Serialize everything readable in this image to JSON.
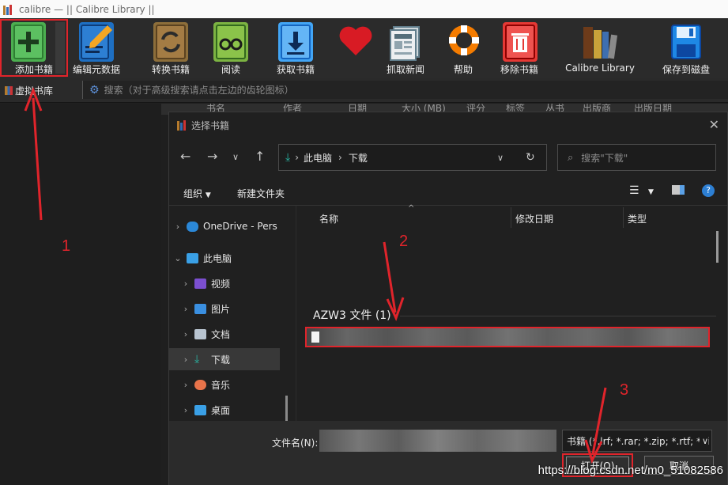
{
  "window": {
    "title": "calibre — || Calibre Library ||"
  },
  "toolbar": [
    {
      "id": "add",
      "label": "添加书籍",
      "icon": "add-book-icon",
      "color": "#4caf50"
    },
    {
      "id": "edit",
      "label": "编辑元数据",
      "icon": "edit-metadata-icon",
      "color": "#1e88e5"
    },
    {
      "id": "convert",
      "label": "转换书籍",
      "icon": "convert-book-icon",
      "color": "#8d6e3a"
    },
    {
      "id": "view",
      "label": "阅读",
      "icon": "view-book-icon",
      "color": "#7cb342"
    },
    {
      "id": "fetch",
      "label": "获取书籍",
      "icon": "get-books-icon",
      "color": "#42a5f5"
    },
    {
      "id": "donate",
      "label": "",
      "icon": "heart-icon",
      "color": "#d81b24"
    },
    {
      "id": "news",
      "label": "抓取新闻",
      "icon": "news-icon",
      "color": "#9e9e9e"
    },
    {
      "id": "help",
      "label": "帮助",
      "icon": "lifebuoy-icon",
      "color": "#f57c00"
    },
    {
      "id": "remove",
      "label": "移除书籍",
      "icon": "remove-book-icon",
      "color": "#e53935"
    },
    {
      "id": "library",
      "label": "Calibre Library",
      "icon": "library-icon",
      "color": "#795548"
    },
    {
      "id": "save",
      "label": "保存到磁盘",
      "icon": "save-disk-icon",
      "color": "#1976d2"
    }
  ],
  "virtual_library": "虚拟书库",
  "search_placeholder": "搜索（对于高级搜索请点击左边的齿轮图标）",
  "columns": [
    "书名",
    "作者",
    "日期",
    "大小 (MB)",
    "评分",
    "标签",
    "丛书",
    "出版商",
    "出版日期"
  ],
  "dialog": {
    "title": "选择书籍",
    "breadcrumb": [
      "此电脑",
      "下载"
    ],
    "search_placeholder": "搜索\"下载\"",
    "organize": "组织",
    "new_folder": "新建文件夹",
    "nav": [
      {
        "label": "OneDrive - Pers",
        "icon": "onedrive-icon",
        "color": "#2b88d8"
      },
      {
        "label": "此电脑",
        "icon": "computer-icon",
        "color": "#3aa0e6"
      },
      {
        "label": "视频",
        "icon": "video-folder-icon",
        "color": "#7b4fd0"
      },
      {
        "label": "图片",
        "icon": "pictures-folder-icon",
        "color": "#3a8fe0"
      },
      {
        "label": "文档",
        "icon": "documents-folder-icon",
        "color": "#b8c4d0"
      },
      {
        "label": "下载",
        "icon": "downloads-folder-icon",
        "color": "#2ab3a2"
      },
      {
        "label": "音乐",
        "icon": "music-folder-icon",
        "color": "#e8734a"
      },
      {
        "label": "桌面",
        "icon": "desktop-folder-icon",
        "color": "#3aa0e6"
      }
    ],
    "file_columns": [
      "名称",
      "修改日期",
      "类型"
    ],
    "group_label": "AZW3 文件 (1)",
    "filename_label": "文件名(N):",
    "filter_text": "书籍 (*.lrf; *.rar; *.zip; *.rtf; *.li",
    "open_button": "打开(O)",
    "cancel_button": "取消"
  },
  "annotations": [
    "1",
    "2",
    "3"
  ],
  "watermark": "https://blog.csdn.net/m0_51082586",
  "colors": {
    "highlight": "#e0242b"
  }
}
